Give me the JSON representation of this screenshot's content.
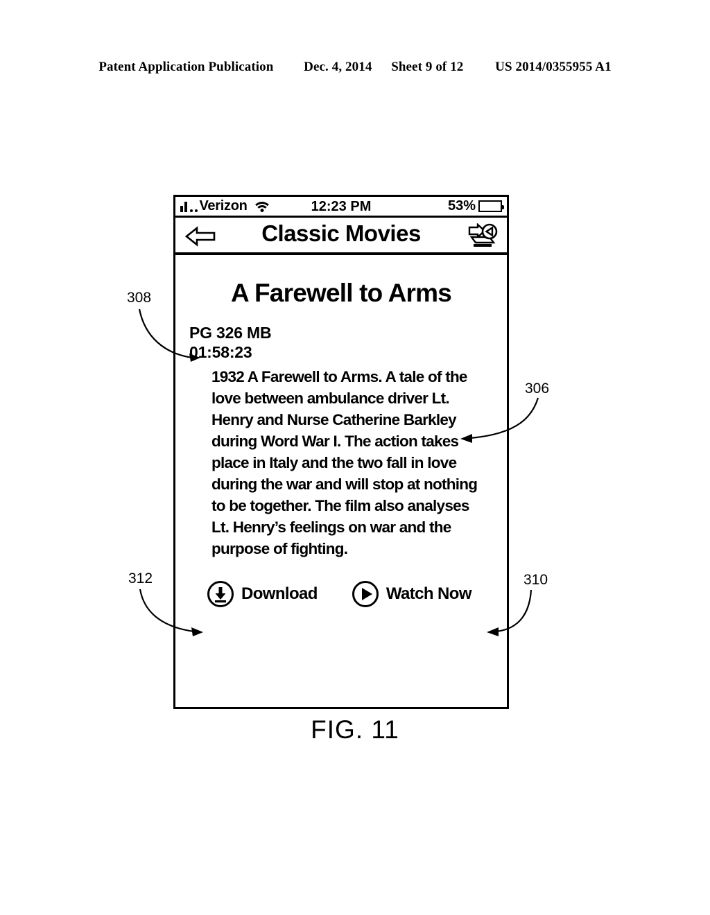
{
  "patent_header": {
    "publication": "Patent Application Publication",
    "date": "Dec. 4, 2014",
    "sheet": "Sheet 9 of 12",
    "number": "US 2014/0355955 A1"
  },
  "figure": {
    "caption": "FIG. 11"
  },
  "device": {
    "status_bar": {
      "carrier": "Verizon",
      "signal_icon": "signal-bars-icon",
      "wifi_icon": "wifi-icon",
      "time": "12:23 PM",
      "battery_percent": "53%",
      "battery_level": 53,
      "battery_icon": "battery-icon"
    },
    "title_bar": {
      "back_icon": "back-arrow-icon",
      "title": "Classic Movies",
      "cast_icon": "cast-to-device-icon"
    },
    "movie": {
      "title": "A Farewell to Arms",
      "rating_size": "PG 326 MB",
      "duration": "01:58:23",
      "description": "1932 A Farewell to Arms. A tale of the love between ambulance driver Lt. Henry and Nurse Catherine Barkley during Word War I. The action takes place in Italy and the two fall in love during the war and will stop at nothing to be together. The film also analyses Lt. Henry’s feelings on war and the purpose of fighting."
    },
    "actions": [
      {
        "label": "Download",
        "icon": "download-circle-icon"
      },
      {
        "label": "Watch Now",
        "icon": "play-circle-icon"
      }
    ]
  },
  "reference_numerals": [
    {
      "id": "306",
      "label": "306",
      "points_to": "movie-description"
    },
    {
      "id": "308",
      "label": "308",
      "points_to": "movie-metadata"
    },
    {
      "id": "310",
      "label": "310",
      "points_to": "watch-now-button"
    },
    {
      "id": "312",
      "label": "312",
      "points_to": "download-button"
    }
  ],
  "colors": {
    "ink": "#000000",
    "background": "#ffffff"
  }
}
